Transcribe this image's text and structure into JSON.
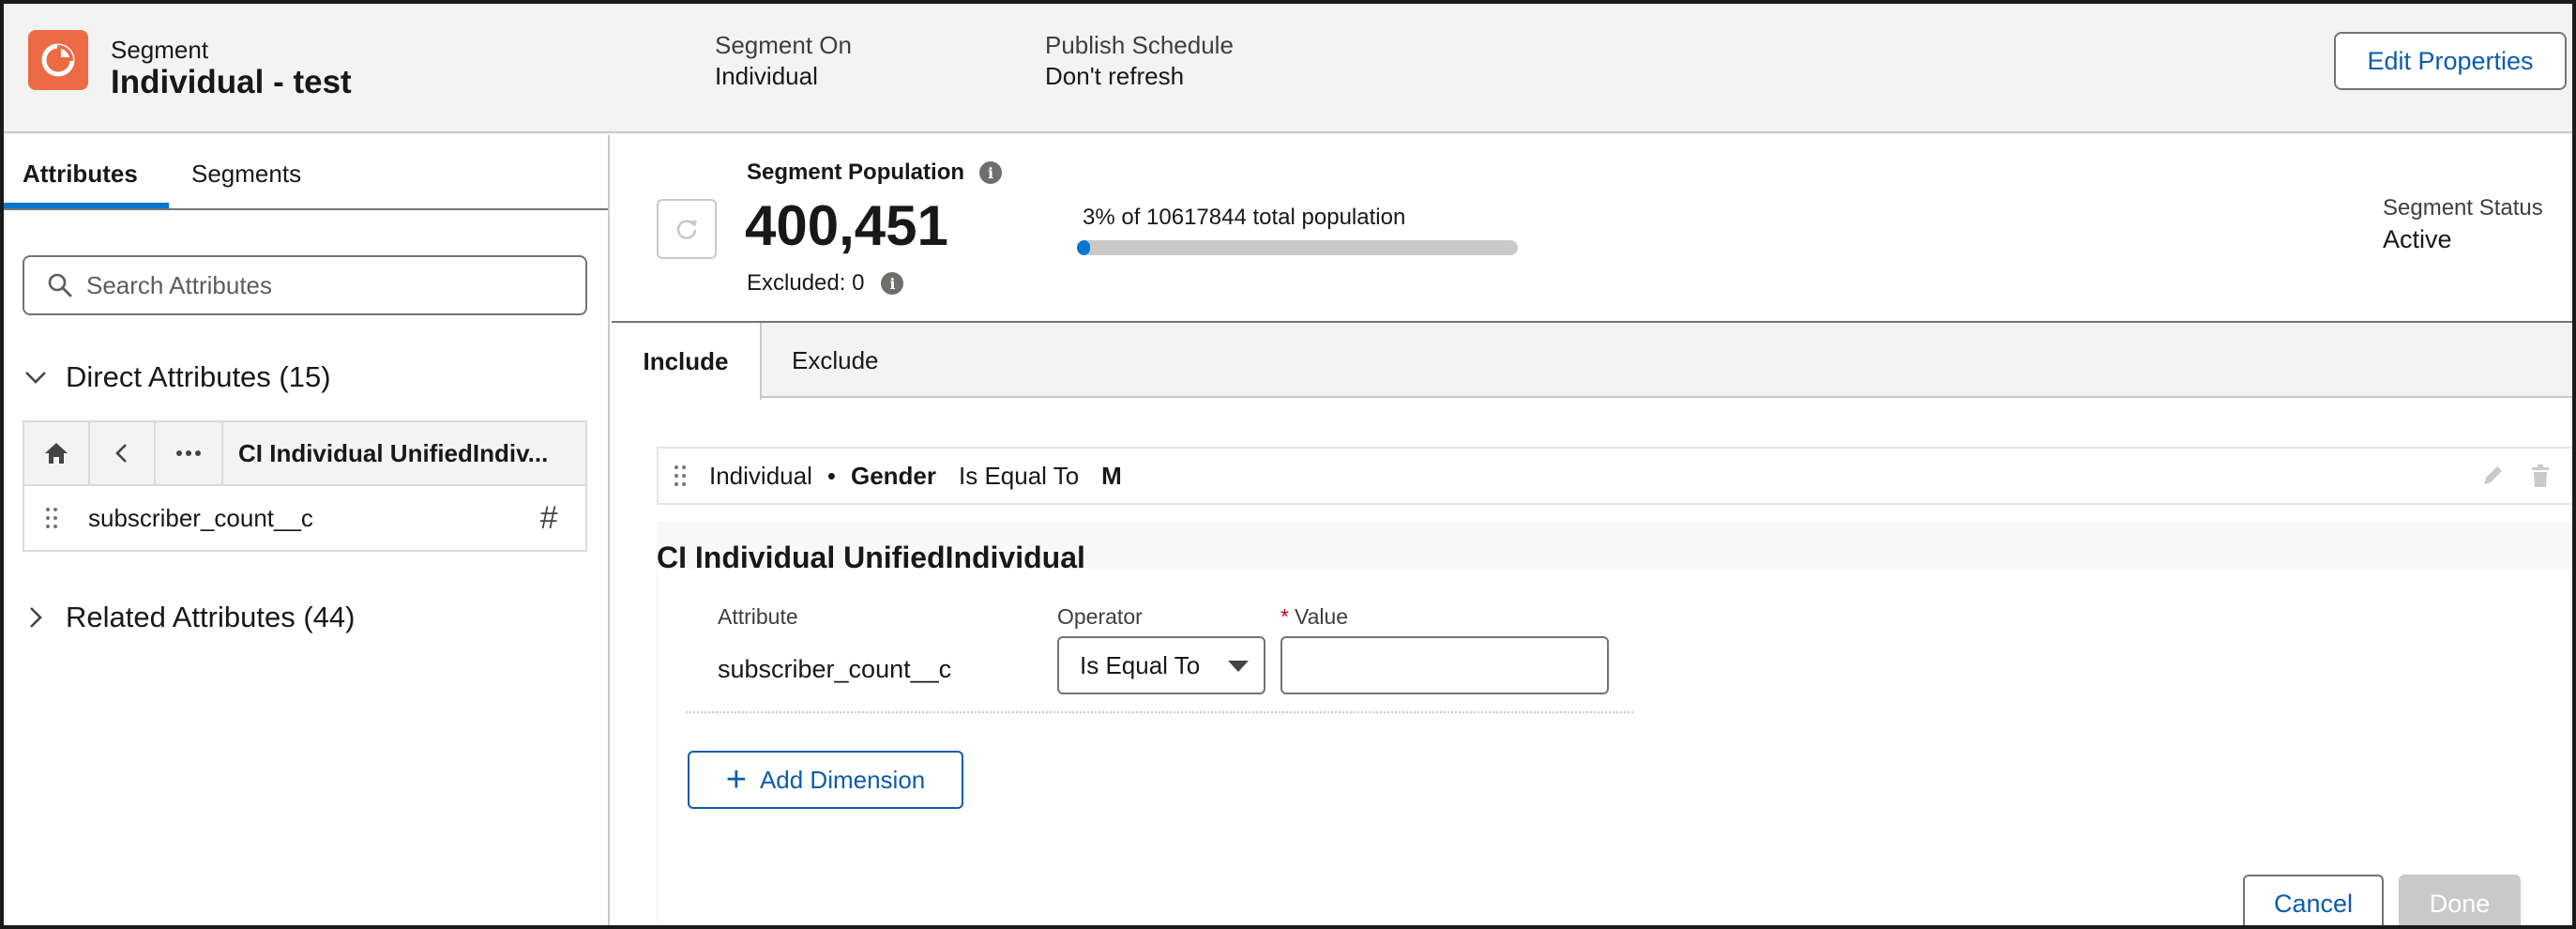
{
  "header": {
    "object_label": "Segment",
    "title": "Individual - test",
    "segment_on_label": "Segment On",
    "segment_on_value": "Individual",
    "publish_schedule_label": "Publish Schedule",
    "publish_schedule_value": "Don't refresh",
    "edit_properties_label": "Edit Properties"
  },
  "left_panel": {
    "tabs": [
      {
        "label": "Attributes",
        "active": true
      },
      {
        "label": "Segments",
        "active": false
      }
    ],
    "search": {
      "placeholder": "Search Attributes",
      "value": ""
    },
    "direct_attributes_label": "Direct Attributes (15)",
    "path_title": "CI Individual UnifiedIndiv...",
    "attributes": [
      {
        "name": "subscriber_count__c",
        "type_icon": "number-icon"
      }
    ],
    "related_attributes_label": "Related Attributes (44)"
  },
  "population": {
    "label": "Segment Population",
    "value": "400,451",
    "excluded_label": "Excluded: 0",
    "percent_text": "3% of 10617844 total population",
    "percent": 3,
    "status_label": "Segment Status",
    "status_value": "Active"
  },
  "canvas_tabs": [
    {
      "label": "Include",
      "active": true
    },
    {
      "label": "Exclude",
      "active": false
    }
  ],
  "criteria": {
    "object": "Individual",
    "separator": "•",
    "field": "Gender",
    "operator": "Is Equal To",
    "value": "M"
  },
  "editor": {
    "title": "CI Individual UnifiedIndividual",
    "attribute_label": "Attribute",
    "operator_label": "Operator",
    "value_label": "Value",
    "required_mark": "*",
    "attribute_value": "subscriber_count__c",
    "operator_value": "Is Equal To",
    "value_input": "",
    "add_dimension_label": "Add Dimension",
    "cancel_label": "Cancel",
    "done_label": "Done"
  },
  "colors": {
    "brand_logo": "#ec6b44",
    "accent": "#0176d3",
    "link": "#0b5cab",
    "required": "#ba0517"
  }
}
